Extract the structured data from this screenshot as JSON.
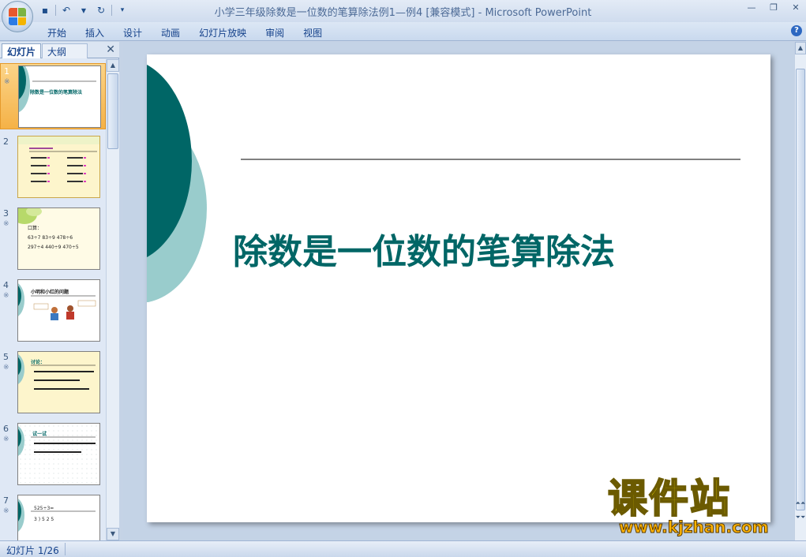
{
  "window": {
    "title": "小学三年级除数是一位数的笔算除法例1—例4 [兼容模式] - Microsoft PowerPoint"
  },
  "quick_access": {
    "icons": [
      "save-icon",
      "undo-icon",
      "redo-icon",
      "customize-icon"
    ]
  },
  "ribbon": {
    "tabs": [
      "开始",
      "插入",
      "设计",
      "动画",
      "幻灯片放映",
      "审阅",
      "视图"
    ]
  },
  "left_pane": {
    "tab_slides": "幻灯片",
    "tab_outline": "大纲",
    "thumbnails": [
      {
        "num": "1",
        "mark": "※",
        "title": "除数是一位数的笔算除法"
      },
      {
        "num": "2",
        "mark": ""
      },
      {
        "num": "3",
        "mark": "※",
        "lines": [
          "口算：",
          "63÷7   83÷9   478÷6",
          "297÷4   440÷9   470÷5"
        ]
      },
      {
        "num": "4",
        "mark": "※",
        "title": "小明和小红的问题"
      },
      {
        "num": "5",
        "mark": "※",
        "title": "讨论："
      },
      {
        "num": "6",
        "mark": "※",
        "title": "试一试"
      },
      {
        "num": "7",
        "mark": "※",
        "lines": [
          "525÷3=",
          "3 ) 5 2 5"
        ]
      }
    ]
  },
  "slide": {
    "title": "除数是一位数的笔算除法",
    "accent_dark": "#006666",
    "accent_light": "#99cccc"
  },
  "status": {
    "slide_indicator": "幻灯片 1/26"
  },
  "watermark": {
    "cn": "课件站",
    "url": "www.kjzhan.com"
  }
}
